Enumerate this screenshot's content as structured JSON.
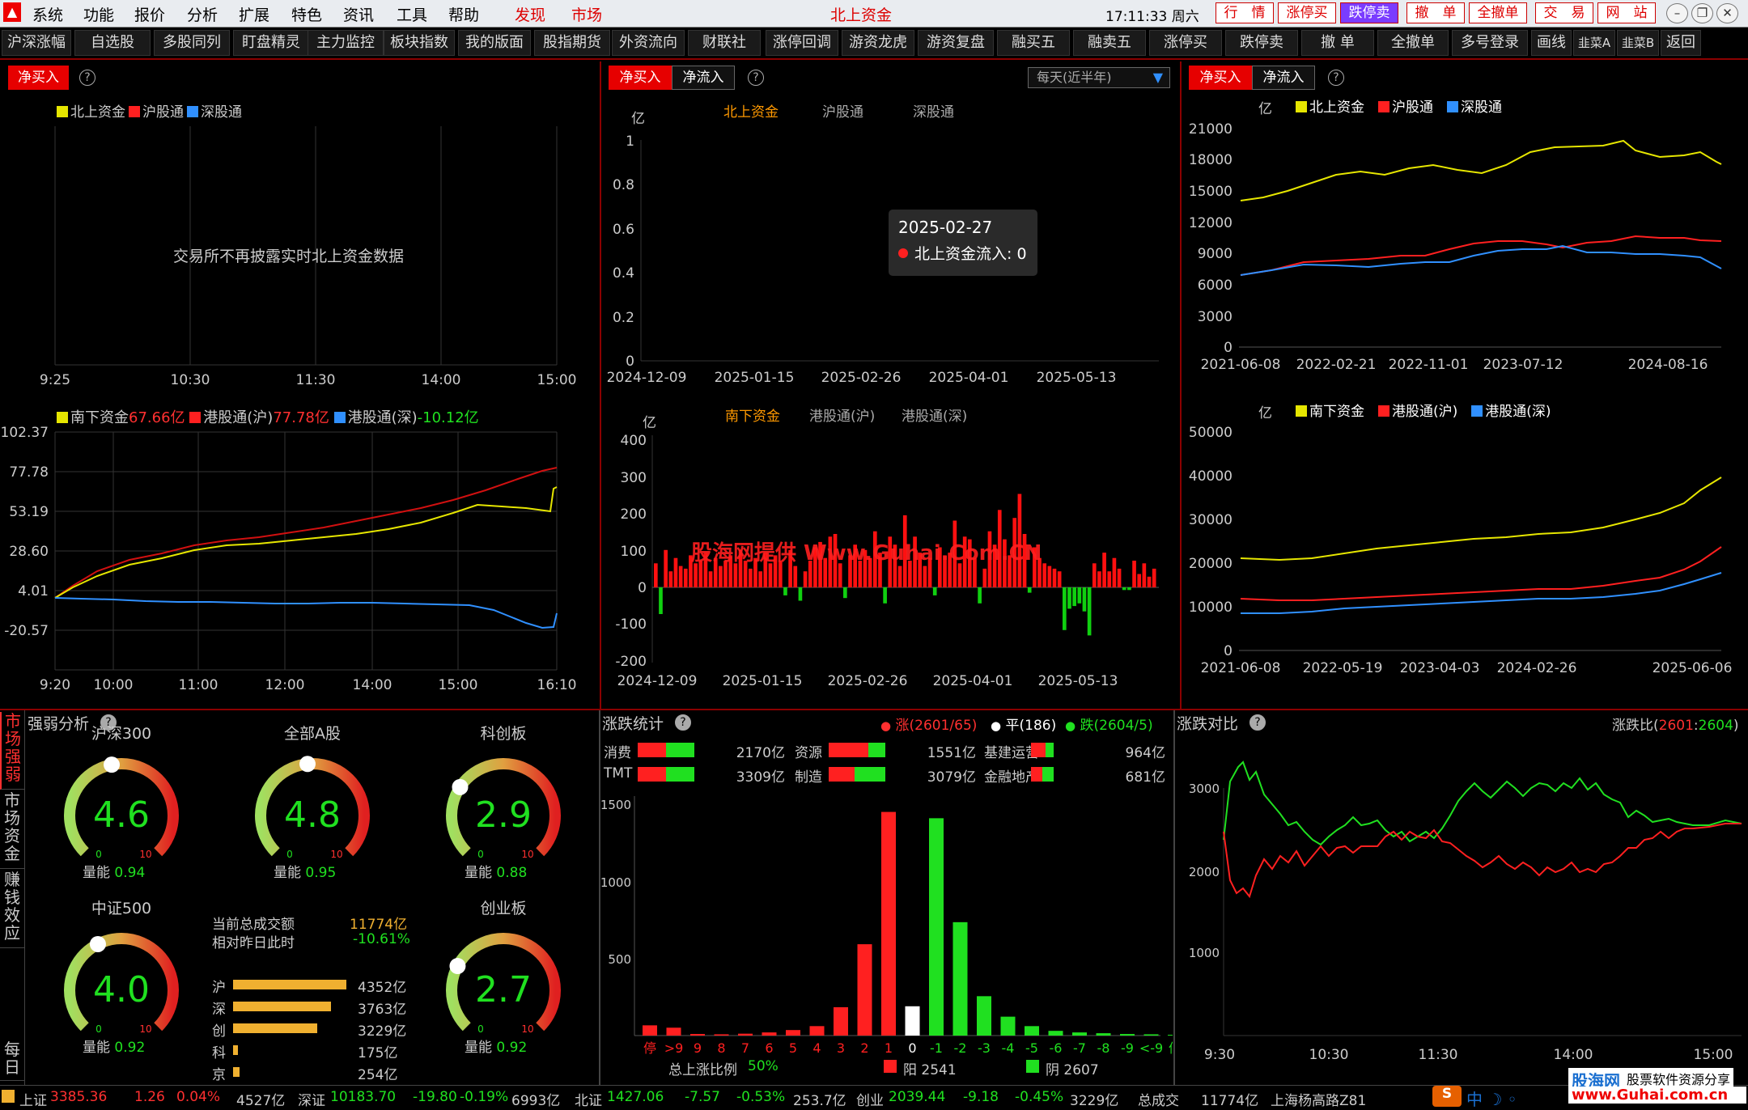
{
  "colors": {
    "red": "#ff2020",
    "green": "#00e020",
    "yellow": "#e6e600",
    "blue": "#3090ff",
    "orange": "#ff9900"
  },
  "menu": {
    "items": [
      "系统",
      "功能",
      "报价",
      "分析",
      "扩展",
      "特色",
      "资讯",
      "工具",
      "帮助"
    ],
    "faxian": "发现",
    "shichang": "市场",
    "title": "北上资金",
    "time": "17:11:33 周六",
    "right": [
      "行　情",
      "涨停买",
      "跌停卖",
      "撤　单",
      "全撤单",
      "交　易",
      "网　站"
    ]
  },
  "toolbar": [
    "沪深涨幅",
    "自选股",
    "多股同列",
    "盯盘精灵",
    "主力监控",
    "板块指数",
    "我的版面",
    "股指期货",
    "外资流向",
    "财联社",
    "涨停回调",
    "游资龙虎",
    "游资复盘",
    "融买五",
    "融卖五",
    "涨停买",
    "跌停卖",
    "撤 单",
    "全撤单",
    "多号登录",
    "画线",
    "韭菜A",
    "韭菜B",
    "返回"
  ],
  "p1": {
    "tab": "净买入",
    "legend": [
      "北上资金",
      "沪股通",
      "深股通"
    ],
    "notice": "交易所不再披露实时北上资金数据",
    "xticks": [
      "9:25",
      "10:30",
      "11:30",
      "14:00",
      "15:00"
    ]
  },
  "p4": {
    "legend": [
      {
        "name": "南下资金",
        "value": "67.66亿"
      },
      {
        "name": "港股通(沪)",
        "value": "77.78亿"
      },
      {
        "name": "港股通(深)",
        "value": "-10.12亿"
      }
    ],
    "yticks": [
      "102.37",
      "77.78",
      "53.19",
      "28.60",
      "4.01",
      "-20.57"
    ],
    "xticks": [
      "9:20",
      "10:00",
      "11:00",
      "12:00",
      "14:00",
      "15:00",
      "16:10"
    ]
  },
  "p2": {
    "tabs": [
      "净买入",
      "净流入"
    ],
    "dropdown": "每天(近半年)",
    "unit": "亿",
    "legend": [
      "北上资金",
      "沪股通",
      "深股通"
    ],
    "yticks": [
      "1",
      "0.8",
      "0.6",
      "0.4",
      "0.2",
      "0"
    ],
    "xticks": [
      "2024-12-09",
      "2025-01-15",
      "2025-02-26",
      "2025-04-01",
      "2025-05-13"
    ],
    "tooltip": {
      "date": "2025-02-27",
      "label": "北上资金流入: 0"
    }
  },
  "p5": {
    "unit": "亿",
    "legend": [
      "南下资金",
      "港股通(沪)",
      "港股通(深)"
    ],
    "yticks": [
      "400",
      "300",
      "200",
      "100",
      "0",
      "-100",
      "-200"
    ],
    "xticks": [
      "2024-12-09",
      "2025-01-15",
      "2025-02-26",
      "2025-04-01",
      "2025-05-13"
    ],
    "watermark": "股海网提供 Www.Guhai.Com.CN"
  },
  "p3": {
    "tabs": [
      "净买入",
      "净流入"
    ],
    "unit": "亿",
    "legend": [
      "北上资金",
      "沪股通",
      "深股通"
    ],
    "yticks": [
      "21000",
      "18000",
      "15000",
      "12000",
      "9000",
      "6000",
      "3000",
      "0"
    ],
    "xticks": [
      "2021-06-08",
      "2022-02-21",
      "2022-11-01",
      "2023-07-12",
      "2024-08-16"
    ]
  },
  "p6": {
    "unit": "亿",
    "legend": [
      "南下资金",
      "港股通(沪)",
      "港股通(深)"
    ],
    "yticks": [
      "50000",
      "40000",
      "30000",
      "20000",
      "10000",
      "0"
    ],
    "xticks": [
      "2021-06-08",
      "2022-05-19",
      "2023-04-03",
      "2024-02-26",
      "2025-06-06"
    ]
  },
  "strength": {
    "sidetabs": [
      "市场强弱",
      "市场资金",
      "赚钱效应",
      "每日"
    ],
    "title": "强弱分析",
    "gauges": [
      {
        "name": "沪深300",
        "value": "4.6",
        "v": 4.6,
        "qn": "0.94"
      },
      {
        "name": "全部A股",
        "value": "4.8",
        "v": 4.8,
        "qn": "0.95"
      },
      {
        "name": "科创板",
        "value": "2.9",
        "v": 2.9,
        "qn": "0.88"
      },
      {
        "name": "中证500",
        "value": "4.0",
        "v": 4.0,
        "qn": "0.92"
      },
      {
        "name": "创业板",
        "value": "2.7",
        "v": 2.7,
        "qn": "0.92"
      }
    ],
    "gmin": "0",
    "gmax": "10",
    "qnlabel": "量能",
    "turnover_label": "当前总成交额",
    "turnover": "11774亿",
    "compare_label": "相对昨日此时",
    "compare": "-10.61%",
    "bars": [
      {
        "name": "沪",
        "value": "4352亿",
        "v": 4352
      },
      {
        "name": "深",
        "value": "3763亿",
        "v": 3763
      },
      {
        "name": "创",
        "value": "3229亿",
        "v": 3229
      },
      {
        "name": "科",
        "value": "175亿",
        "v": 175
      },
      {
        "name": "京",
        "value": "254亿",
        "v": 254
      }
    ]
  },
  "updown": {
    "title": "涨跌统计",
    "up": "涨(2601/65)",
    "flat": "平(186)",
    "down": "跌(2604/5)",
    "sectors": [
      {
        "name": "消费",
        "value": "2170亿",
        "r": 0.5
      },
      {
        "name": "资源",
        "value": "1551亿",
        "r": 0.7
      },
      {
        "name": "基建运营",
        "value": "964亿",
        "r": 0.65
      },
      {
        "name": "TMT",
        "value": "3309亿",
        "r": 0.5
      },
      {
        "name": "制造",
        "value": "3079亿",
        "r": 0.45
      },
      {
        "name": "金融地产",
        "value": "681亿",
        "r": 0.5
      }
    ],
    "yticks": [
      "1500",
      "1000",
      "500"
    ],
    "cats": [
      "停",
      ">9",
      "9",
      "8",
      "7",
      "6",
      "5",
      "4",
      "3",
      "2",
      "1",
      "0",
      "-1",
      "-2",
      "-3",
      "-4",
      "-5",
      "-6",
      "-7",
      "-8",
      "-9",
      "<-9",
      "停"
    ],
    "counts": [
      65,
      50,
      10,
      8,
      12,
      20,
      35,
      60,
      180,
      580,
      1420,
      186,
      1380,
      720,
      250,
      120,
      60,
      30,
      20,
      15,
      10,
      8,
      5
    ],
    "ratio_label": "总上涨比例",
    "ratio": "50%",
    "yang": "阳 2541",
    "yin": "阴 2607"
  },
  "ratio": {
    "title": "涨跌对比",
    "label": "涨跌比",
    "up": "2601",
    "down": "2604",
    "yticks": [
      "3000",
      "2000",
      "1000"
    ],
    "xticks": [
      "9:30",
      "10:30",
      "11:30",
      "14:00",
      "15:00"
    ]
  },
  "status": {
    "sh": "上证",
    "sh_val": "3385.36",
    "sh_chg": "1.26",
    "sh_pct": "0.04%",
    "sh_amt": "4527亿",
    "sz": "深证",
    "sz_val": "10183.70",
    "sz_chg": "-19.80",
    "sz_pct": "-0.19%",
    "sz_amt": "6993亿",
    "bz": "北证",
    "bz_val": "1427.06",
    "bz_chg": "-7.57",
    "bz_pct": "-0.53%",
    "bz_amt": "253.7亿",
    "cy": "创业",
    "cy_val": "2039.44",
    "cy_chg": "-9.18",
    "cy_pct": "-0.45%",
    "cy_amt": "3229亿",
    "total_label": "总成交",
    "total": "11774亿",
    "location": "上海杨高路Z81",
    "brand": "股海网",
    "brand_sub": "股票软件资源分享",
    "brand_url": "www.Guhai.com.cn"
  }
}
